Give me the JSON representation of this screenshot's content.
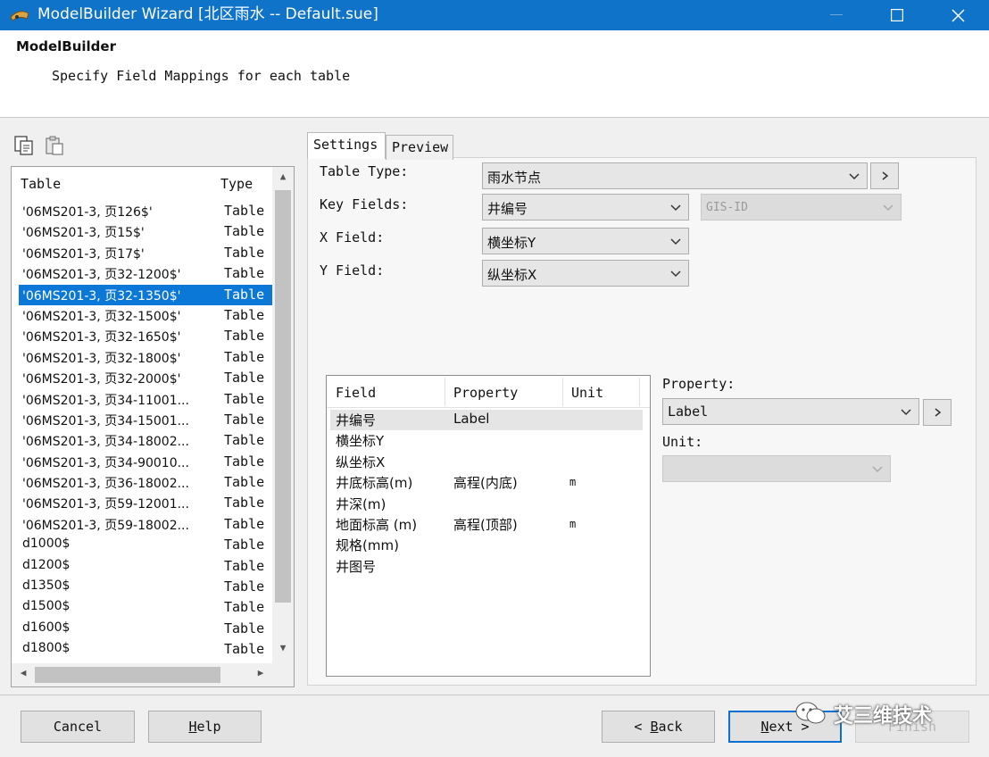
{
  "window": {
    "title": "ModelBuilder Wizard [北区雨水 -- Default.sue]",
    "icons": {
      "app": "model-app-icon",
      "maximize": "maximize-icon",
      "close": "close-icon"
    }
  },
  "header": {
    "title": "ModelBuilder",
    "subtitle": "Specify Field Mappings for each table"
  },
  "toolbar": {
    "icons": [
      "copy-icon",
      "paste-icon"
    ]
  },
  "table_list": {
    "columns": [
      "Table",
      "Type"
    ],
    "selected_index": 4,
    "rows": [
      {
        "name": "'06MS201-3, 页126$'",
        "type": "Table"
      },
      {
        "name": "'06MS201-3, 页15$'",
        "type": "Table"
      },
      {
        "name": "'06MS201-3, 页17$'",
        "type": "Table"
      },
      {
        "name": "'06MS201-3, 页32-1200$'",
        "type": "Table"
      },
      {
        "name": "'06MS201-3, 页32-1350$'",
        "type": "Table"
      },
      {
        "name": "'06MS201-3, 页32-1500$'",
        "type": "Table"
      },
      {
        "name": "'06MS201-3, 页32-1650$'",
        "type": "Table"
      },
      {
        "name": "'06MS201-3, 页32-1800$'",
        "type": "Table"
      },
      {
        "name": "'06MS201-3, 页32-2000$'",
        "type": "Table"
      },
      {
        "name": "'06MS201-3, 页34-11001...",
        "type": "Table"
      },
      {
        "name": "'06MS201-3, 页34-15001...",
        "type": "Table"
      },
      {
        "name": "'06MS201-3, 页34-18002...",
        "type": "Table"
      },
      {
        "name": "'06MS201-3, 页34-90010...",
        "type": "Table"
      },
      {
        "name": "'06MS201-3, 页36-18002...",
        "type": "Table"
      },
      {
        "name": "'06MS201-3, 页59-12001...",
        "type": "Table"
      },
      {
        "name": "'06MS201-3, 页59-18002...",
        "type": "Table"
      },
      {
        "name": "d1000$",
        "type": "Table"
      },
      {
        "name": "d1200$",
        "type": "Table"
      },
      {
        "name": "d1350$",
        "type": "Table"
      },
      {
        "name": "d1500$",
        "type": "Table"
      },
      {
        "name": "d1600$",
        "type": "Table"
      },
      {
        "name": "d1800$",
        "type": "Table"
      }
    ]
  },
  "tabs": [
    {
      "label": "Settings",
      "active": true
    },
    {
      "label": "Preview",
      "active": false
    }
  ],
  "settings": {
    "table_type_label": "Table Type:",
    "table_type_value": "雨水节点",
    "key_fields_label": "Key Fields:",
    "key_fields_value": "井编号",
    "key_fields_secondary": "GIS-ID",
    "x_field_label": "X Field:",
    "x_field_value": "横坐标Y",
    "y_field_label": "Y Field:",
    "y_field_value": "纵坐标X"
  },
  "field_list": {
    "columns": [
      "Field",
      "Property",
      "Unit"
    ],
    "rows": [
      {
        "field": "井编号",
        "property": "Label",
        "unit": ""
      },
      {
        "field": "横坐标Y",
        "property": "",
        "unit": ""
      },
      {
        "field": "纵坐标X",
        "property": "",
        "unit": ""
      },
      {
        "field": "井底标高(m)",
        "property": "高程(内底)",
        "unit": "m"
      },
      {
        "field": "井深(m)",
        "property": "",
        "unit": ""
      },
      {
        "field": "地面标高 (m)",
        "property": "高程(顶部)",
        "unit": "m"
      },
      {
        "field": "规格(mm)",
        "property": "",
        "unit": ""
      },
      {
        "field": "井图号",
        "property": "",
        "unit": ""
      }
    ]
  },
  "property_panel": {
    "property_label": "Property:",
    "property_value": "Label",
    "unit_label": "Unit:",
    "unit_value": ""
  },
  "buttons": {
    "cancel": "Cancel",
    "help_first": "H",
    "help_rest": "elp",
    "back_prefix": "< ",
    "back_first": "B",
    "back_rest": "ack",
    "next_first": "N",
    "next_rest": "ext >",
    "finish": "Finish"
  },
  "watermark": {
    "text": "艾三维技术"
  },
  "colors": {
    "titlebar": "#0f73c9",
    "selection": "#0b78d7",
    "default_button_border": "#0a6fd0"
  }
}
